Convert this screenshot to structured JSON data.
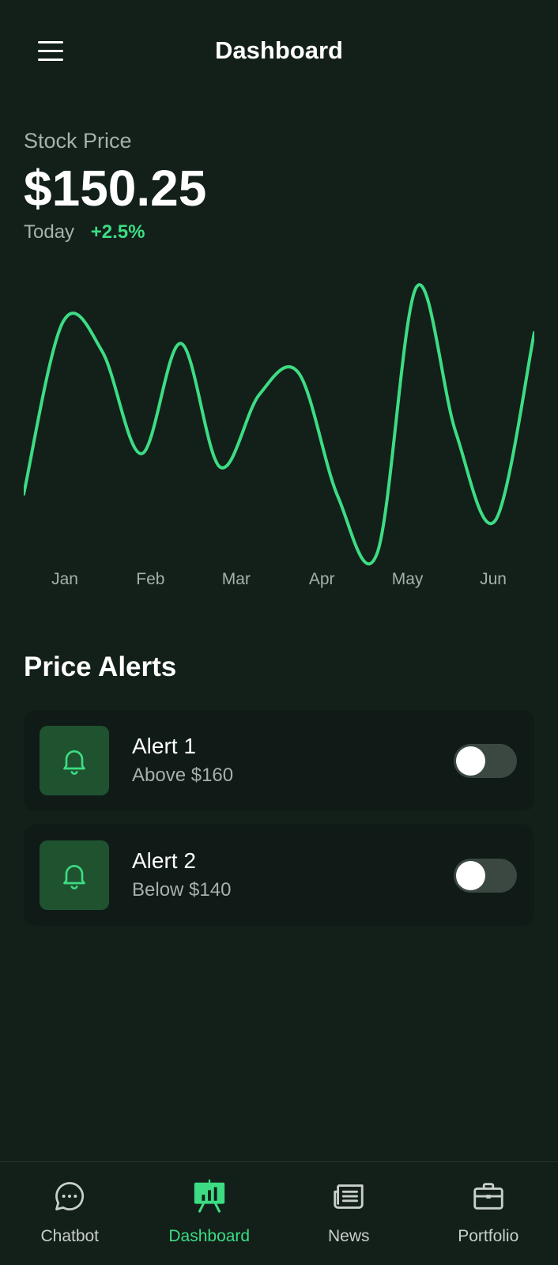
{
  "header": {
    "title": "Dashboard",
    "menu_icon": "hamburger-menu-icon"
  },
  "stock": {
    "label": "Stock Price",
    "price": "$150.25",
    "period_label": "Today",
    "change": "+2.5%",
    "change_color": "#3ddc84"
  },
  "chart_data": {
    "type": "line",
    "x_labels": [
      "Jan",
      "Feb",
      "Mar",
      "Apr",
      "May",
      "Jun"
    ],
    "series": [
      {
        "color": "#3ddc84",
        "values": [
          0.23,
          0.87,
          0.76,
          0.38,
          0.79,
          0.33,
          0.6,
          0.68,
          0.22,
          0.01,
          1.0,
          0.46,
          0.13,
          0.83
        ]
      }
    ],
    "grid": false,
    "smooth": true
  },
  "alerts": {
    "title": "Price Alerts",
    "items": [
      {
        "name": "Alert 1",
        "condition": "Above $160",
        "enabled": false,
        "icon": "bell-icon"
      },
      {
        "name": "Alert 2",
        "condition": "Below $140",
        "enabled": false,
        "icon": "bell-icon"
      }
    ]
  },
  "nav": {
    "items": [
      {
        "label": "Chatbot",
        "icon": "chat-bubble-icon",
        "active": false
      },
      {
        "label": "Dashboard",
        "icon": "presentation-chart-icon",
        "active": true
      },
      {
        "label": "News",
        "icon": "newspaper-icon",
        "active": false
      },
      {
        "label": "Portfolio",
        "icon": "briefcase-icon",
        "active": false
      }
    ]
  },
  "colors": {
    "background": "#122019",
    "accent": "#3ddc84",
    "card": "#101a16",
    "icon_box": "#1f5330",
    "muted_text": "#a7b0ab"
  }
}
